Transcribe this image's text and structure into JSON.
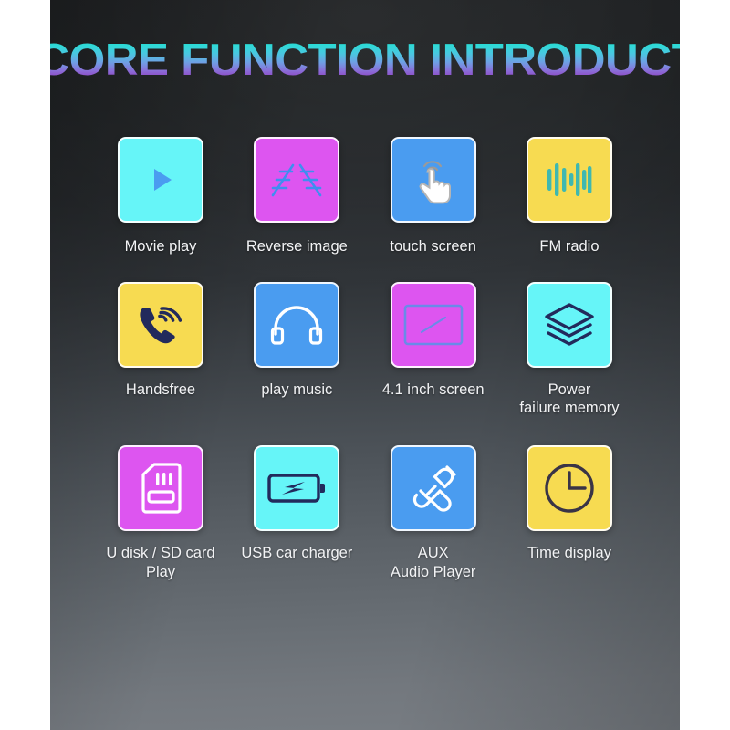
{
  "page": {
    "title": "CORE FUNCTION INTRODUCTION"
  },
  "colors": {
    "cyan": "#66f5f8",
    "magenta": "#dd55f0",
    "blue": "#4a9cf0",
    "yellow": "#f7db51",
    "icon_navy": "#222a5c",
    "icon_blue": "#4a9cf0",
    "icon_teal": "#3fb8b0",
    "icon_white": "#ffffff",
    "icon_dark": "#3a3446",
    "title_gradient_top": "#19d7d2",
    "title_gradient_bottom": "#8a33b8",
    "background_top": "#1e2022",
    "background_bottom": "#787d83"
  },
  "grid": {
    "rows": [
      {
        "cells": [
          {
            "label": "Movie play",
            "icon": "play-icon",
            "tile_color": "cyan"
          },
          {
            "label": "Reverse image",
            "icon": "parking-guide-icon",
            "tile_color": "magenta"
          },
          {
            "label": "touch screen",
            "icon": "touch-hand-icon",
            "tile_color": "blue"
          },
          {
            "label": "FM radio",
            "icon": "waveform-icon",
            "tile_color": "yellow"
          }
        ]
      },
      {
        "cells": [
          {
            "label": "Handsfree",
            "icon": "phone-call-icon",
            "tile_color": "yellow"
          },
          {
            "label": "play music",
            "icon": "headphones-icon",
            "tile_color": "blue"
          },
          {
            "label": "4.1 inch screen",
            "icon": "screen-icon",
            "tile_color": "magenta"
          },
          {
            "label": "Power\nfailure memory",
            "icon": "layers-icon",
            "tile_color": "cyan"
          }
        ]
      },
      {
        "cells": [
          {
            "label": "U disk / SD card\nPlay",
            "icon": "sd-card-icon",
            "tile_color": "magenta"
          },
          {
            "label": "USB car charger",
            "icon": "battery-charging-icon",
            "tile_color": "cyan"
          },
          {
            "label": "AUX\nAudio Player",
            "icon": "audio-plug-icon",
            "tile_color": "blue"
          },
          {
            "label": "Time display",
            "icon": "clock-icon",
            "tile_color": "yellow"
          }
        ]
      }
    ]
  }
}
